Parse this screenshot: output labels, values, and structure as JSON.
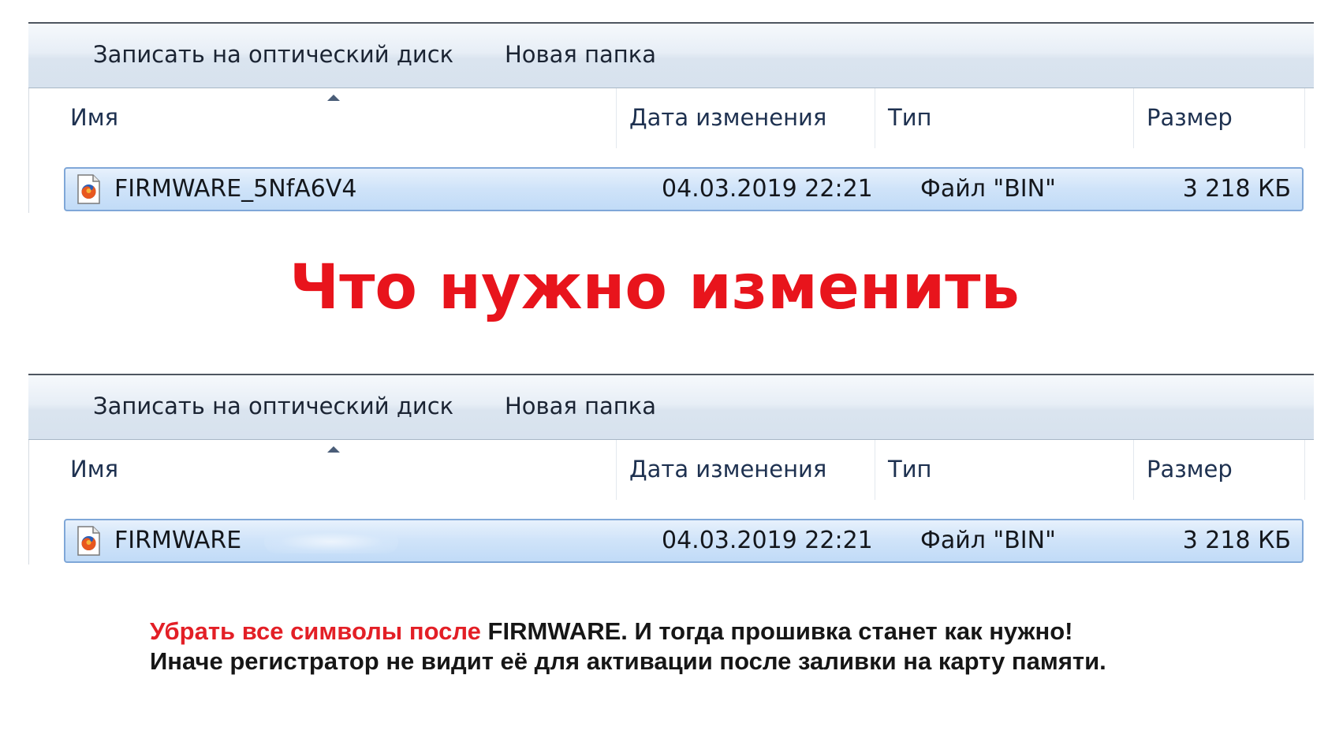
{
  "panels": [
    {
      "toolbar": {
        "burn_label": "Записать на оптический диск",
        "new_folder_label": "Новая папка"
      },
      "columns": {
        "name": "Имя",
        "date": "Дата изменения",
        "type": "Тип",
        "size": "Размер"
      },
      "file": {
        "name": "FIRMWARE_5NfA6V4",
        "date": "04.03.2019 22:21",
        "type": "Файл \"BIN\"",
        "size": "3 218 КБ",
        "icon": "firefox-file-icon"
      }
    },
    {
      "toolbar": {
        "burn_label": "Записать на оптический диск",
        "new_folder_label": "Новая папка"
      },
      "columns": {
        "name": "Имя",
        "date": "Дата изменения",
        "type": "Тип",
        "size": "Размер"
      },
      "file": {
        "name": "FIRMWARE",
        "date": "04.03.2019 22:21",
        "type": "Файл \"BIN\"",
        "size": "3 218 КБ",
        "icon": "firefox-file-icon"
      }
    }
  ],
  "headline": "Что нужно изменить",
  "note": {
    "line1_red": "Убрать все символы после",
    "line1_black": " FIRMWARE. И тогда прошивка станет как нужно!",
    "line2": "Иначе регистратор не видит её для активации после заливки на карту памяти."
  },
  "colors": {
    "headline": "#e8141c",
    "note_red": "#e31f26",
    "selection": "#cfe3f9",
    "selection_border": "#7fa7d8"
  }
}
